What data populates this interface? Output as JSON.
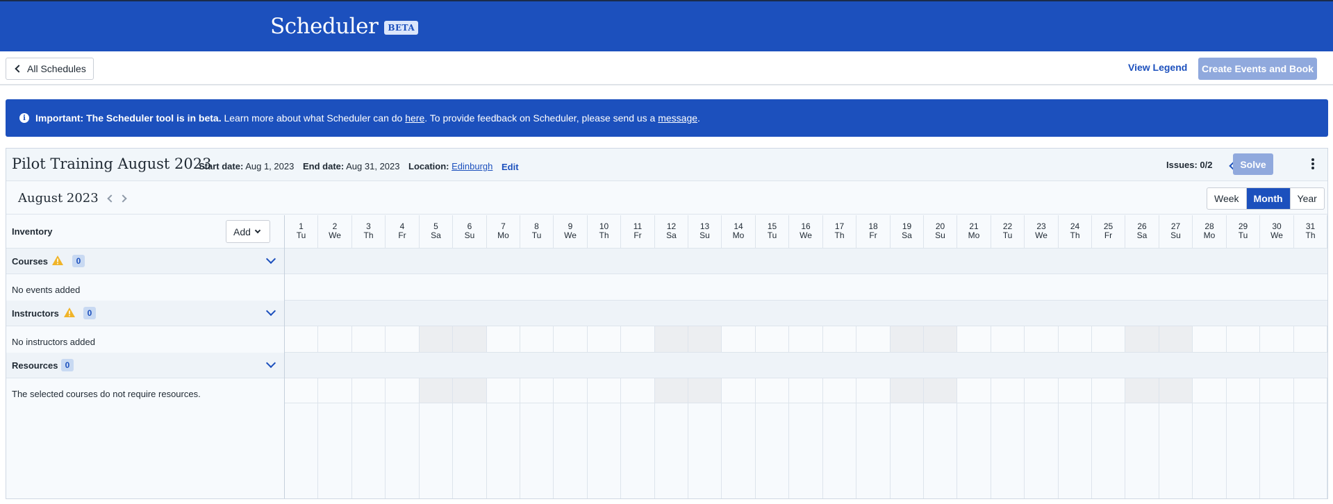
{
  "header": {
    "title": "Scheduler",
    "badge": "BETA",
    "bg_color": "#1c50bd"
  },
  "actions": {
    "back_label": "All Schedules",
    "view_legend_label": "View Legend",
    "create_label": "Create Events and Book"
  },
  "banner": {
    "strong": "Important: The Scheduler tool is in beta.",
    "text1": " Learn more about what Scheduler can do ",
    "link1": "here",
    "text2": ". To provide feedback on Scheduler, please send us a ",
    "link2": "message",
    "text3": "."
  },
  "schedule": {
    "title": "Pilot Training August 2023",
    "start_label": "Start date:",
    "start_value": "Aug 1, 2023",
    "end_label": "End date:",
    "end_value": "Aug 31, 2023",
    "location_label": "Location:",
    "location_value": "Edinburgh",
    "edit_label": "Edit",
    "issues": "Issues: 0/2",
    "solve_label": "Solve"
  },
  "calendar": {
    "month_label": "August 2023",
    "views": [
      "Week",
      "Month",
      "Year"
    ],
    "active_view": "Month",
    "days": [
      {
        "d": "1",
        "w": "Tu"
      },
      {
        "d": "2",
        "w": "We"
      },
      {
        "d": "3",
        "w": "Th"
      },
      {
        "d": "4",
        "w": "Fr"
      },
      {
        "d": "5",
        "w": "Sa"
      },
      {
        "d": "6",
        "w": "Su"
      },
      {
        "d": "7",
        "w": "Mo"
      },
      {
        "d": "8",
        "w": "Tu"
      },
      {
        "d": "9",
        "w": "We"
      },
      {
        "d": "10",
        "w": "Th"
      },
      {
        "d": "11",
        "w": "Fr"
      },
      {
        "d": "12",
        "w": "Sa"
      },
      {
        "d": "13",
        "w": "Su"
      },
      {
        "d": "14",
        "w": "Mo"
      },
      {
        "d": "15",
        "w": "Tu"
      },
      {
        "d": "16",
        "w": "We"
      },
      {
        "d": "17",
        "w": "Th"
      },
      {
        "d": "18",
        "w": "Fr"
      },
      {
        "d": "19",
        "w": "Sa"
      },
      {
        "d": "20",
        "w": "Su"
      },
      {
        "d": "21",
        "w": "Mo"
      },
      {
        "d": "22",
        "w": "Tu"
      },
      {
        "d": "23",
        "w": "We"
      },
      {
        "d": "24",
        "w": "Th"
      },
      {
        "d": "25",
        "w": "Fr"
      },
      {
        "d": "26",
        "w": "Sa"
      },
      {
        "d": "27",
        "w": "Su"
      },
      {
        "d": "28",
        "w": "Mo"
      },
      {
        "d": "29",
        "w": "Tu"
      },
      {
        "d": "30",
        "w": "We"
      },
      {
        "d": "31",
        "w": "Th"
      }
    ]
  },
  "inventory": {
    "label": "Inventory",
    "add_label": "Add",
    "courses": {
      "label": "Courses",
      "count": "0",
      "empty": "No events added"
    },
    "instructors": {
      "label": "Instructors",
      "count": "0",
      "empty": "No instructors added"
    },
    "resources": {
      "label": "Resources",
      "count": "0",
      "empty": "The selected courses do not require resources."
    }
  }
}
